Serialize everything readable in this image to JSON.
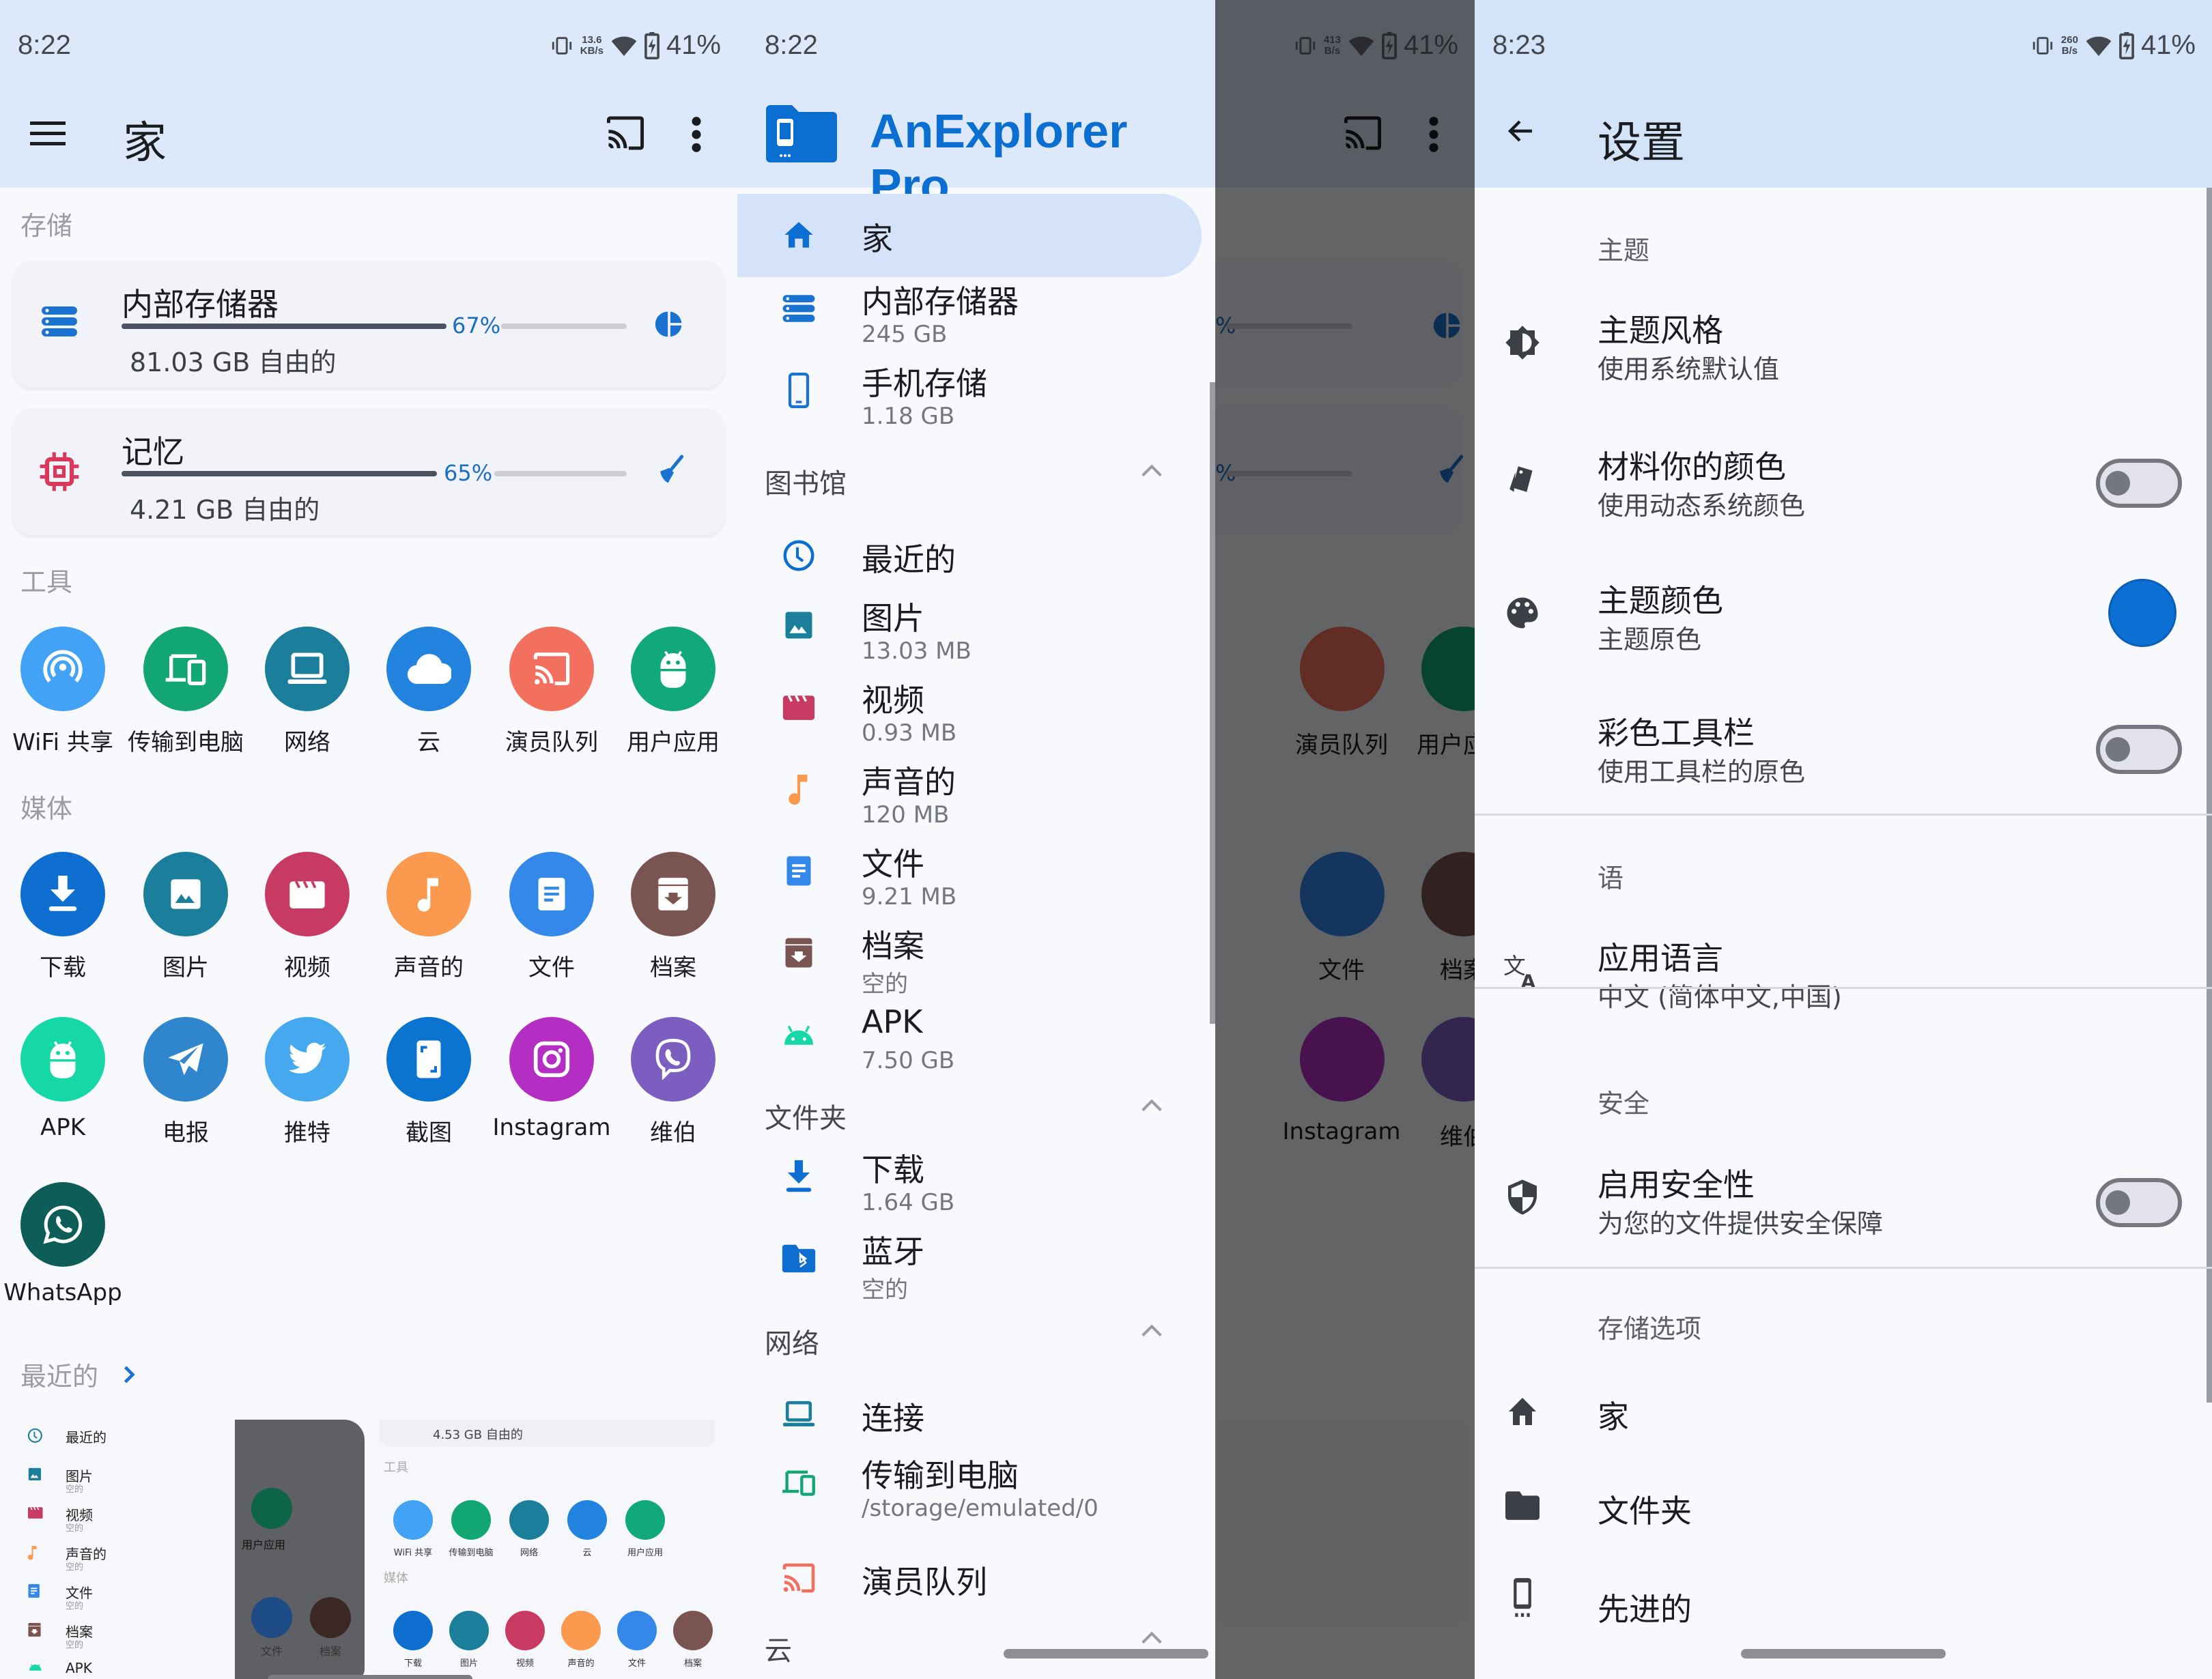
{
  "home": {
    "status": {
      "time": "8:22",
      "speed_value": "13.6",
      "speed_unit": "KB/s",
      "battery": "41%"
    },
    "appbar": {
      "title": "家",
      "menu_icon": "menu-icon",
      "cast_icon": "cast-icon",
      "more_icon": "more-vert-icon"
    },
    "storage_label": "存储",
    "cards": [
      {
        "title": "内部存储器",
        "percent_label": "67%",
        "used_fraction": 0.67,
        "free": "81.03 GB 自由的",
        "icon": "storage-icon",
        "action_icon": "pie-chart-icon",
        "icon_color": "#1a73d0"
      },
      {
        "title": "记忆",
        "percent_label": "65%",
        "used_fraction": 0.65,
        "free": "4.21 GB 自由的",
        "icon": "memory-chip-icon",
        "action_icon": "broom-clean-icon",
        "icon_color": "#d8395a"
      }
    ],
    "tools_label": "工具",
    "tools": [
      {
        "label": "WiFi 共享",
        "icon": "wifi-share-icon",
        "color": "#42a2f5"
      },
      {
        "label": "传输到电脑",
        "icon": "transfer-pc-icon",
        "color": "#12a672"
      },
      {
        "label": "网络",
        "icon": "laptop-icon",
        "color": "#1b7f9b"
      },
      {
        "label": "云",
        "icon": "cloud-icon",
        "color": "#2384e0"
      },
      {
        "label": "演员队列",
        "icon": "cast-icon",
        "color": "#f3705e"
      },
      {
        "label": "用户应用",
        "icon": "android-icon",
        "color": "#11a87a"
      }
    ],
    "media_label": "媒体",
    "media": [
      {
        "label": "下载",
        "icon": "download-icon",
        "color": "#0e6fd0"
      },
      {
        "label": "图片",
        "icon": "image-icon",
        "color": "#1b7f9b"
      },
      {
        "label": "视频",
        "icon": "video-clapper-icon",
        "color": "#c73a63"
      },
      {
        "label": "声音的",
        "icon": "music-note-icon",
        "color": "#fb9a4f"
      },
      {
        "label": "文件",
        "icon": "document-icon",
        "color": "#3488ea"
      },
      {
        "label": "档案",
        "icon": "archive-icon",
        "color": "#7a5450"
      },
      {
        "label": "APK",
        "icon": "android-icon",
        "color": "#16d7a6"
      },
      {
        "label": "电报",
        "icon": "telegram-icon",
        "color": "#2f86cc"
      },
      {
        "label": "推特",
        "icon": "twitter-icon",
        "color": "#46a9f0"
      },
      {
        "label": "截图",
        "icon": "screenshot-icon",
        "color": "#0b74d0"
      },
      {
        "label": "Instagram",
        "icon": "instagram-icon",
        "color": "#b52ec4"
      },
      {
        "label": "维伯",
        "icon": "viber-icon",
        "color": "#7b5ec0"
      },
      {
        "label": "WhatsApp",
        "icon": "whatsapp-icon",
        "color": "#0d5d58"
      }
    ],
    "recent_label": "最近的",
    "recent_thumbs": {
      "list": [
        {
          "title": "最近的",
          "sub": ""
        },
        {
          "title": "图片",
          "sub": "空的"
        },
        {
          "title": "视频",
          "sub": "空的"
        },
        {
          "title": "声音的",
          "sub": "空的"
        },
        {
          "title": "文件",
          "sub": "空的"
        },
        {
          "title": "档案",
          "sub": "空的"
        },
        {
          "title": "APK",
          "sub": ""
        }
      ],
      "dim_labels": [
        "用户应用",
        "文件",
        "档案"
      ],
      "home_free": "4.53 GB 自由的",
      "home_tools_label": "工具",
      "home_tools": [
        "WiFi 共享",
        "传输到电脑",
        "网络",
        "云",
        "用户应用"
      ],
      "home_media_label": "媒体",
      "home_media": [
        "下载",
        "图片",
        "视频",
        "声音的",
        "文件",
        "档案"
      ]
    }
  },
  "drawer": {
    "status": {
      "time": "8:22",
      "speed_value": "413",
      "speed_unit": "B/s",
      "battery": "41%"
    },
    "app_name": "AnExplorer Pro",
    "brand_color": "#0a6fd1",
    "items_top": [
      {
        "title": "家",
        "sub": "",
        "icon": "home-icon",
        "active": true
      },
      {
        "title": "内部存储器",
        "sub": "245 GB",
        "icon": "storage-icon"
      },
      {
        "title": "手机存储",
        "sub": "1.18 GB",
        "icon": "phone-icon"
      }
    ],
    "library_header": "图书馆",
    "library": [
      {
        "title": "最近的",
        "sub": "",
        "icon": "clock-icon"
      },
      {
        "title": "图片",
        "sub": "13.03 MB",
        "icon": "image-icon"
      },
      {
        "title": "视频",
        "sub": "0.93 MB",
        "icon": "video-clapper-icon"
      },
      {
        "title": "声音的",
        "sub": "120 MB",
        "icon": "music-note-icon"
      },
      {
        "title": "文件",
        "sub": "9.21 MB",
        "icon": "document-icon"
      },
      {
        "title": "档案",
        "sub": "空的",
        "icon": "archive-icon"
      },
      {
        "title": "APK",
        "sub": "7.50 GB",
        "icon": "android-icon"
      }
    ],
    "folders_header": "文件夹",
    "folders": [
      {
        "title": "下载",
        "sub": "1.64 GB",
        "icon": "download-icon"
      },
      {
        "title": "蓝牙",
        "sub": "空的",
        "icon": "bluetooth-folder-icon"
      }
    ],
    "network_header": "网络",
    "network": [
      {
        "title": "连接",
        "sub": "",
        "icon": "laptop-icon"
      },
      {
        "title": "传输到电脑",
        "sub": "/storage/emulated/0",
        "icon": "transfer-pc-icon"
      },
      {
        "title": "演员队列",
        "sub": "",
        "icon": "cast-icon"
      }
    ],
    "cloud_header": "云",
    "behind": {
      "pct1": "%",
      "pct2": "%",
      "tool_labels": [
        "演员队列",
        "用户应用"
      ],
      "media_labels": [
        "文件",
        "档案"
      ],
      "media2_labels": [
        "Instagram",
        "维伯"
      ]
    }
  },
  "settings": {
    "status": {
      "time": "8:23",
      "speed_value": "260",
      "speed_unit": "B/s",
      "battery": "41%"
    },
    "title": "设置",
    "sections": {
      "theme": "主题",
      "language": "语",
      "security": "安全",
      "storage": "存储选项"
    },
    "theme_items": [
      {
        "title": "主题风格",
        "sub": "使用系统默认值",
        "icon": "brightness-icon"
      },
      {
        "title": "材料你的颜色",
        "sub": "使用动态系统颜色",
        "icon": "swatch-icon",
        "toggle": false
      },
      {
        "title": "主题颜色",
        "sub": "主题原色",
        "icon": "palette-icon",
        "swatch": "#0b6fd3"
      },
      {
        "title": "彩色工具栏",
        "sub": "使用工具栏的原色",
        "icon": "toolbar-icon",
        "toggle": false
      }
    ],
    "language_item": {
      "title": "应用语言",
      "sub": "中文 (简体中文,中国)",
      "icon": "translate-icon"
    },
    "security_item": {
      "title": "启用安全性",
      "sub": "为您的文件提供安全保障",
      "icon": "shield-icon",
      "toggle": false
    },
    "storage_items": [
      {
        "title": "家",
        "icon": "home-icon"
      },
      {
        "title": "文件夹",
        "icon": "folder-icon"
      },
      {
        "title": "先进的",
        "icon": "phone-advanced-icon"
      }
    ]
  }
}
